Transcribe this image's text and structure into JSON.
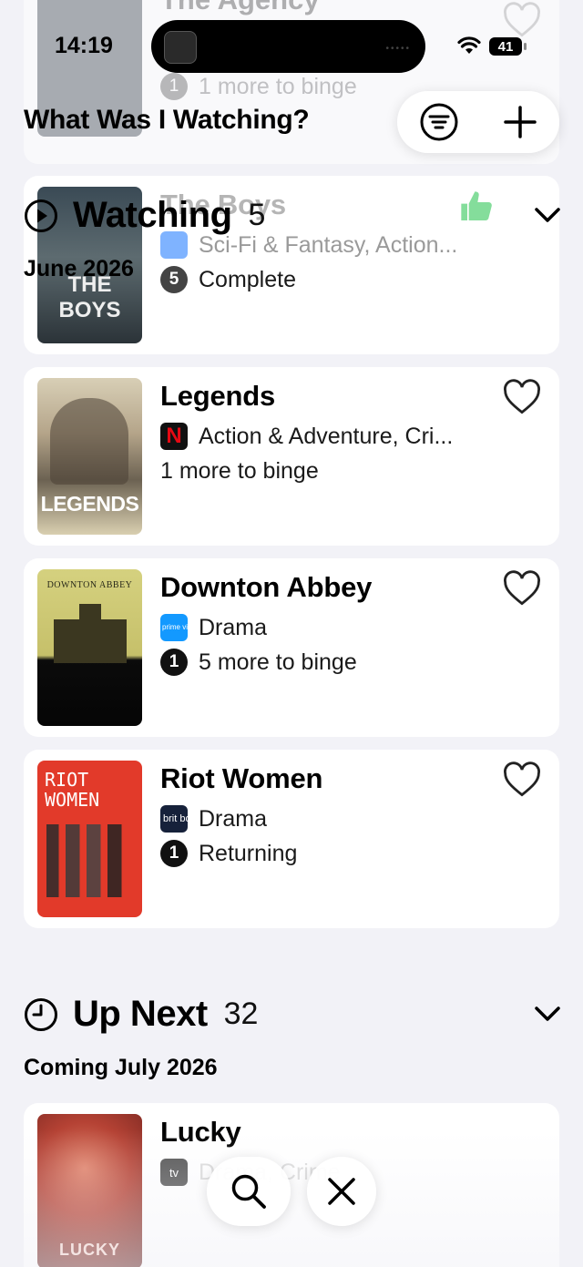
{
  "status_bar": {
    "time": "14:19",
    "battery": "41"
  },
  "app": {
    "title": "What Was I Watching?"
  },
  "top_ghost_card": {
    "title": "The Agency",
    "row": "1 more to binge"
  },
  "watching": {
    "title": "Watching",
    "count": "5",
    "date_header": "June 2026",
    "items": [
      {
        "title": "The Boys",
        "genres": "Sci-Fi & Fantasy, Action...",
        "status_num": "5",
        "status": "Complete",
        "poster_text": "THE BOYS"
      },
      {
        "title": "Legends",
        "service": "N",
        "genres": "Action & Adventure, Cri...",
        "status": "1 more to binge",
        "poster_text": "LEGENDS"
      },
      {
        "title": "Downton Abbey",
        "service": "prime video",
        "genres": "Drama",
        "status_num": "1",
        "status": "5 more to binge",
        "poster_text": "DOWNTON ABBEY"
      },
      {
        "title": "Riot Women",
        "service": "brit box",
        "genres": "Drama",
        "status_num": "1",
        "status": "Returning",
        "poster_text": "RIOT WOMEN"
      }
    ]
  },
  "up_next": {
    "title": "Up Next",
    "count": "32",
    "date_header": "Coming July 2026",
    "items": [
      {
        "title": "Lucky",
        "service": "tv",
        "genres": "Drama, Crime",
        "poster_text": "LUCKY"
      }
    ]
  },
  "colors": {
    "background": "#f2f2f7",
    "card": "#ffffff",
    "netflix": "#e50914",
    "prime": "#1399ff",
    "britbox": "#16213a",
    "thumbs": "#34c759"
  }
}
